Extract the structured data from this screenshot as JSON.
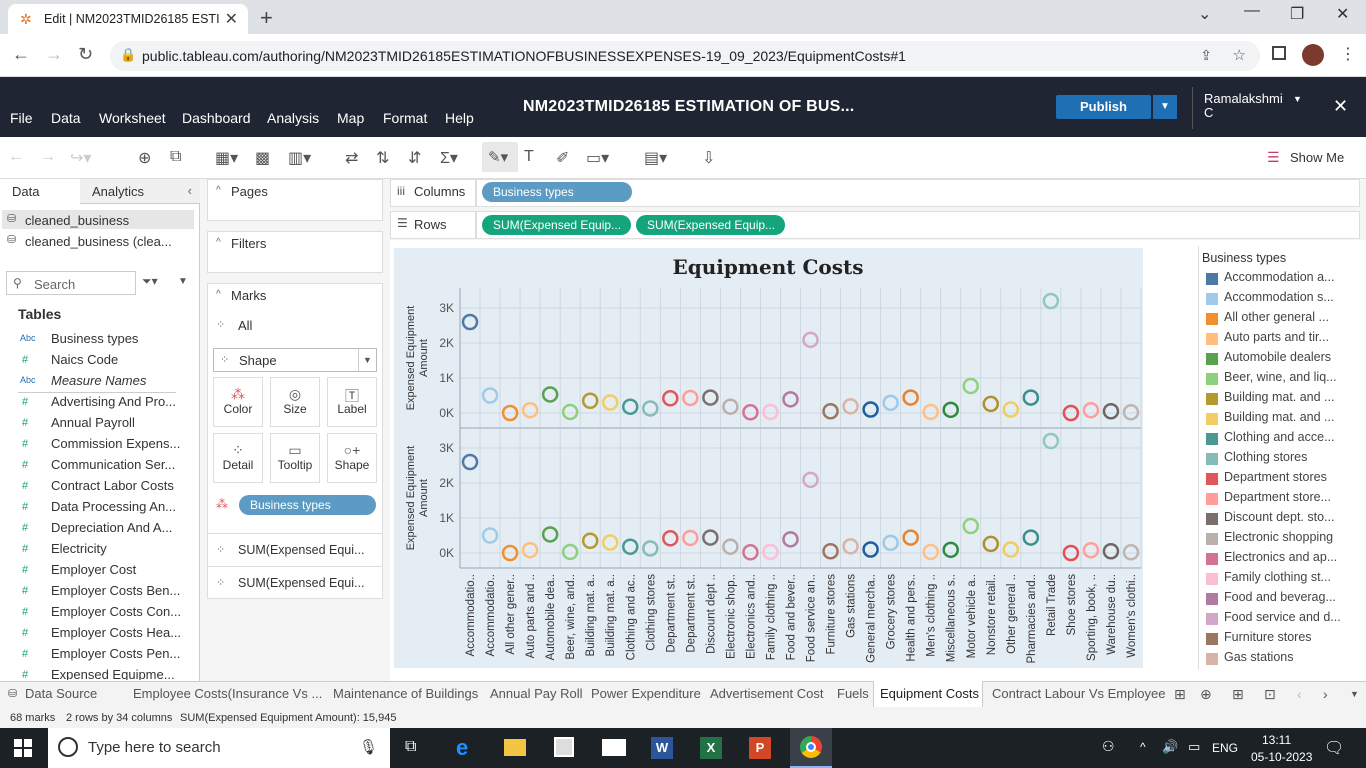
{
  "browser": {
    "tab_title": "Edit | NM2023TMID26185 ESTIM",
    "url": "public.tableau.com/authoring/NM2023TMID26185ESTIMATIONOFBUSINESSEXPENSES-19_09_2023/EquipmentCosts#1"
  },
  "menu": {
    "items": [
      "File",
      "Data",
      "Worksheet",
      "Dashboard",
      "Analysis",
      "Map",
      "Format",
      "Help"
    ],
    "title": "NM2023TMID26185 ESTIMATION OF BUS...",
    "publish": "Publish",
    "user": "Ramalakshmi C"
  },
  "toolbar": {
    "show_me": "Show Me"
  },
  "data_pane": {
    "tab_data": "Data",
    "tab_analytics": "Analytics",
    "sources": [
      "cleaned_business",
      "cleaned_business (clea..."
    ],
    "search_placeholder": "Search",
    "tables_header": "Tables",
    "fields": [
      {
        "icon": "Abc",
        "name": "Business types"
      },
      {
        "icon": "#",
        "name": "Naics Code"
      },
      {
        "icon": "Abc",
        "name": "Measure Names"
      },
      {
        "icon": "#",
        "name": "Advertising And Pro..."
      },
      {
        "icon": "#",
        "name": "Annual Payroll"
      },
      {
        "icon": "#",
        "name": "Commission Expens..."
      },
      {
        "icon": "#",
        "name": "Communication Ser..."
      },
      {
        "icon": "#",
        "name": "Contract Labor Costs"
      },
      {
        "icon": "#",
        "name": "Data Processing An..."
      },
      {
        "icon": "#",
        "name": "Depreciation And A..."
      },
      {
        "icon": "#",
        "name": "Electricity"
      },
      {
        "icon": "#",
        "name": "Employer Cost"
      },
      {
        "icon": "#",
        "name": "Employer Costs Ben..."
      },
      {
        "icon": "#",
        "name": "Employer Costs Con..."
      },
      {
        "icon": "#",
        "name": "Employer Costs Hea..."
      },
      {
        "icon": "#",
        "name": "Employer Costs Pen..."
      },
      {
        "icon": "#",
        "name": "Expensed Equipme..."
      }
    ]
  },
  "cards": {
    "pages": "Pages",
    "filters": "Filters",
    "marks": "Marks",
    "all": "All",
    "mark_type": "Shape",
    "buttons": [
      "Color",
      "Size",
      "Label",
      "Detail",
      "Tooltip",
      "Shape"
    ],
    "color_pill": "Business types",
    "sum_pills": [
      "SUM(Expensed Equi...",
      "SUM(Expensed Equi..."
    ]
  },
  "shelves": {
    "columns_label": "Columns",
    "rows_label": "Rows",
    "columns_pill": "Business types",
    "rows_pills": [
      "SUM(Expensed Equip...",
      "SUM(Expensed Equip..."
    ]
  },
  "chart_data": {
    "type": "scatter",
    "title": "Equipment Costs",
    "ylabel": "Expensed Equipment Amount",
    "yticks": [
      "3K",
      "2K",
      "1K",
      "0K"
    ],
    "ylim": [
      -300,
      3300
    ],
    "categories": [
      "Accommodatio..",
      "Accommodatio..",
      "All other gener..",
      "Auto parts and ..",
      "Automobile dea..",
      "Beer, wine, and..",
      "Building mat. a..",
      "Building mat. a..",
      "Clothing and ac..",
      "Clothing stores",
      "Department st..",
      "Department st..",
      "Discount dept ..",
      "Electronic shop..",
      "Electronics and..",
      "Family clothing ..",
      "Food and bever..",
      "Food service an..",
      "Furniture stores",
      "Gas stations",
      "General mercha..",
      "Grocery stores",
      "Health and pers..",
      "Men's clothing ..",
      "Miscellaneous s..",
      "Motor vehicle a..",
      "Nonstore retail..",
      "Other general ..",
      "Pharmacies and..",
      "Retail Trade",
      "Shoe stores",
      "Sporting, book, ..",
      "Warehouse du..",
      "Women's clothi.."
    ],
    "values": [
      2600,
      500,
      0,
      80,
      530,
      30,
      350,
      300,
      180,
      130,
      420,
      430,
      440,
      180,
      20,
      30,
      390,
      2090,
      50,
      190,
      100,
      290,
      440,
      30,
      90,
      770,
      260,
      100,
      440,
      3200,
      0,
      80,
      50,
      20
    ],
    "colors": [
      "#4e79a7",
      "#a0cbe8",
      "#f28e2b",
      "#ffbe7d",
      "#59a14f",
      "#8cd17d",
      "#b6992d",
      "#f1ce63",
      "#499894",
      "#86bcb6",
      "#e15759",
      "#ff9d9a",
      "#79706e",
      "#bab0ac",
      "#d37295",
      "#fabfd2",
      "#b07aa1",
      "#d4a6c8",
      "#9d7660",
      "#d7b5a6",
      "#1f5fa0",
      "#9ecae9",
      "#e8822b",
      "#ffbf85",
      "#2e8b3e",
      "#8fd17e",
      "#b0902c",
      "#f0cc60",
      "#3a8f8c",
      "#8ec8bf",
      "#e34f52",
      "#ff9e9a",
      "#6f6764",
      "#bdb5b0"
    ]
  },
  "legend": {
    "title": "Business types",
    "items": [
      {
        "label": "Accommodation a...",
        "color": "#4e79a7"
      },
      {
        "label": "Accommodation s...",
        "color": "#a0cbe8"
      },
      {
        "label": "All other general ...",
        "color": "#f28e2b"
      },
      {
        "label": "Auto parts and tir...",
        "color": "#ffbe7d"
      },
      {
        "label": "Automobile dealers",
        "color": "#59a14f"
      },
      {
        "label": "Beer, wine, and liq...",
        "color": "#8cd17d"
      },
      {
        "label": "Building mat. and ...",
        "color": "#b6992d"
      },
      {
        "label": "Building mat. and ...",
        "color": "#f1ce63"
      },
      {
        "label": "Clothing and acce...",
        "color": "#499894"
      },
      {
        "label": "Clothing stores",
        "color": "#86bcb6"
      },
      {
        "label": "Department stores",
        "color": "#e15759"
      },
      {
        "label": "Department store...",
        "color": "#ff9d9a"
      },
      {
        "label": "Discount dept. sto...",
        "color": "#79706e"
      },
      {
        "label": "Electronic shopping",
        "color": "#bab0ac"
      },
      {
        "label": "Electronics and ap...",
        "color": "#d37295"
      },
      {
        "label": "Family clothing st...",
        "color": "#fabfd2"
      },
      {
        "label": "Food and beverag...",
        "color": "#b07aa1"
      },
      {
        "label": "Food service and d...",
        "color": "#d4a6c8"
      },
      {
        "label": "Furniture stores",
        "color": "#9d7660"
      },
      {
        "label": "Gas stations",
        "color": "#d7b5a6"
      }
    ]
  },
  "sheet_tabs": [
    "Data Source",
    "Employee Costs(Insurance Vs ...",
    "Maintenance of Buildings",
    "Annual Pay Roll",
    "Power Expenditure",
    "Advertisement Cost",
    "Fuels",
    "Equipment Costs",
    "Contract Labour Vs Employee"
  ],
  "status": {
    "marks": "68 marks",
    "dims": "2 rows by 34 columns",
    "sum": "SUM(Expensed Equipment Amount): 15,945"
  },
  "taskbar": {
    "search": "Type here to search",
    "lang": "ENG",
    "time": "13:11",
    "date": "05-10-2023"
  }
}
